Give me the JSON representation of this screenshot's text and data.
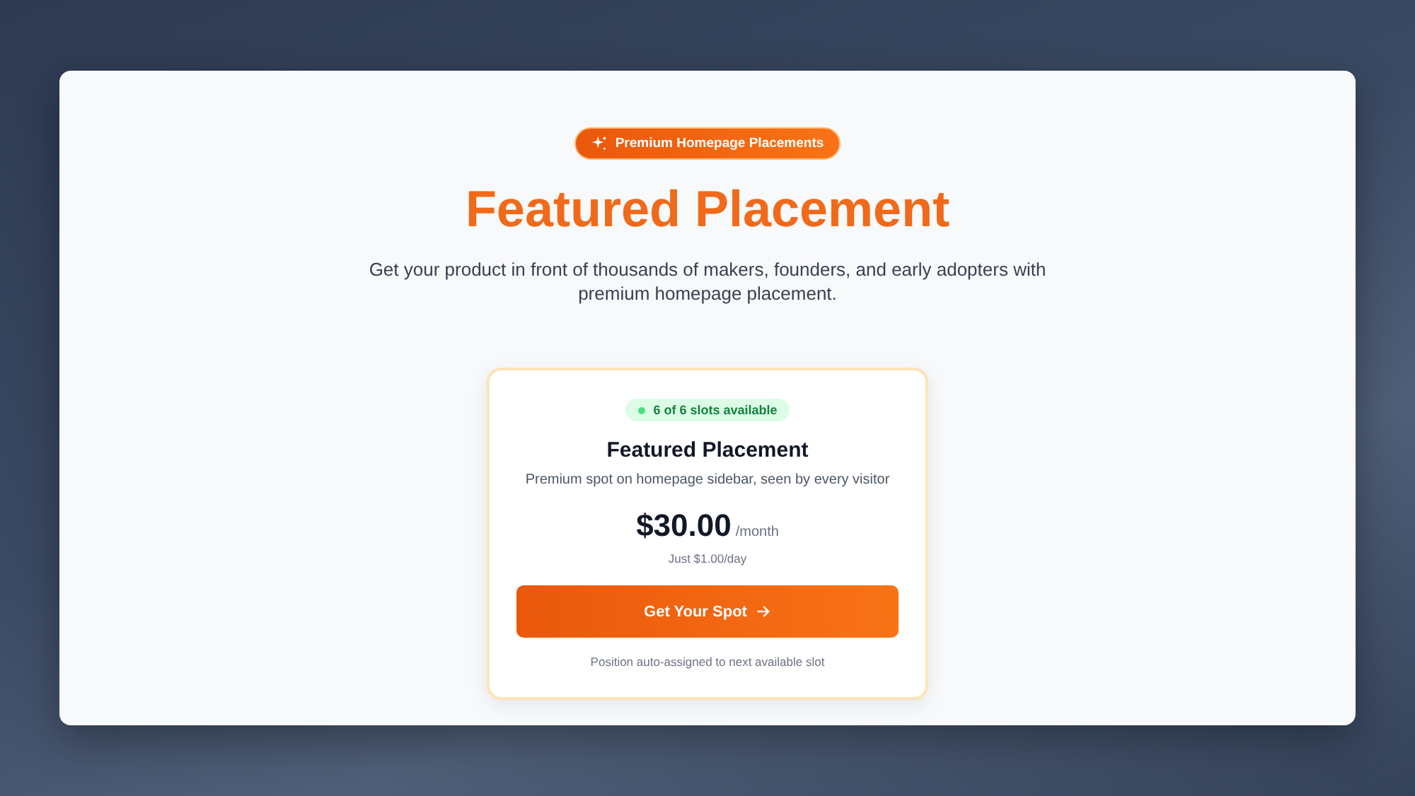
{
  "hero": {
    "badge": "Premium Homepage Placements",
    "title": "Featured Placement",
    "subtitle": "Get your product in front of thousands of makers, founders, and early adopters with premium homepage placement."
  },
  "card": {
    "availability": "6 of 6 slots available",
    "title": "Featured Placement",
    "description": "Premium spot on homepage sidebar, seen by every visitor",
    "price": "$30.00",
    "period": "/month",
    "daily": "Just $1.00/day",
    "button": "Get Your Spot",
    "note": "Position auto-assigned to next available slot"
  }
}
